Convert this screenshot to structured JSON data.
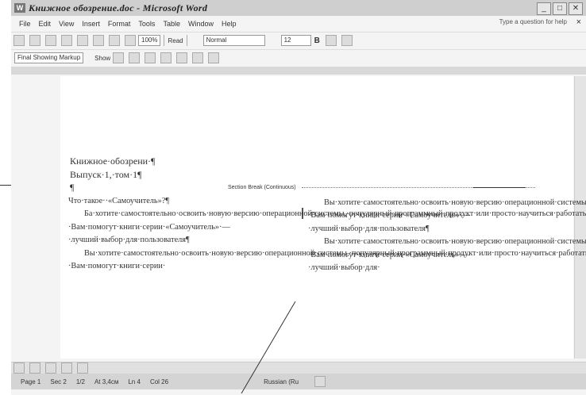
{
  "window": {
    "title": "Книжное обозрение.doc - Microsoft Word"
  },
  "menu": {
    "items": [
      "File",
      "Edit",
      "View",
      "Insert",
      "Format",
      "Tools",
      "Table",
      "Window",
      "Help"
    ],
    "help_prompt": "Type a question for help"
  },
  "toolbar": {
    "zoom": "100%",
    "read_label": "Read",
    "style": "Normal",
    "font_size": "12",
    "bold_label": "B"
  },
  "reviewing": {
    "view": "Final Showing Markup",
    "show_label": "Show"
  },
  "document": {
    "heading1": "Книжное·обозрени·¶",
    "heading2": "Выпуск·1,·том·1¶",
    "para_mark": "¶",
    "section_break": "Section Break (Continuous)",
    "col1": {
      "line1": "Что·такое··«Самоучитель»?¶",
      "para1": "Ба·хотите·самостоятельно·освоить·новую·версию·операционной·системы,·популярный·программный·продукт·или·просто·научиться·работать·на·компьютере?·Вам·помогут·книги·серии·«Самоучитель»·—·лучший·выбор·для·пользователя¶",
      "para2": "Вы·хотите·самостоятельно·освоить·новую·версию·операционной·системы,·популярный·программный·продукт·или·просто·научиться·работать·на·компьютере?·Вам·помогут·книги·серии·"
    },
    "col2": {
      "para1": "Вы·хотите·самостоятельно·освоить·новую·версию·операционной·системы·популярный·программный·продукт·или·просто·научиться·рабтать·на·компьютере?·Вам·помогут·книги·серии·«Самоучитель»·—·лучший·выбор·для·пользователя¶",
      "para2": "Вы·хотите·самостоятельно·освоить·новую·версию·операционной·системы,·популярный·программный·продукт·или·просто·научиться·рабтать·на·компьютере?·Вам·помогут·книги·серии·«Самоучитель»·—·лучший·выбор·для·"
    }
  },
  "status": {
    "page": "Page 1",
    "sec": "Sec 2",
    "page_of": "1/2",
    "at": "At 3,4см",
    "ln": "Ln 4",
    "col": "Col 26",
    "language": "Russian (Ru"
  }
}
